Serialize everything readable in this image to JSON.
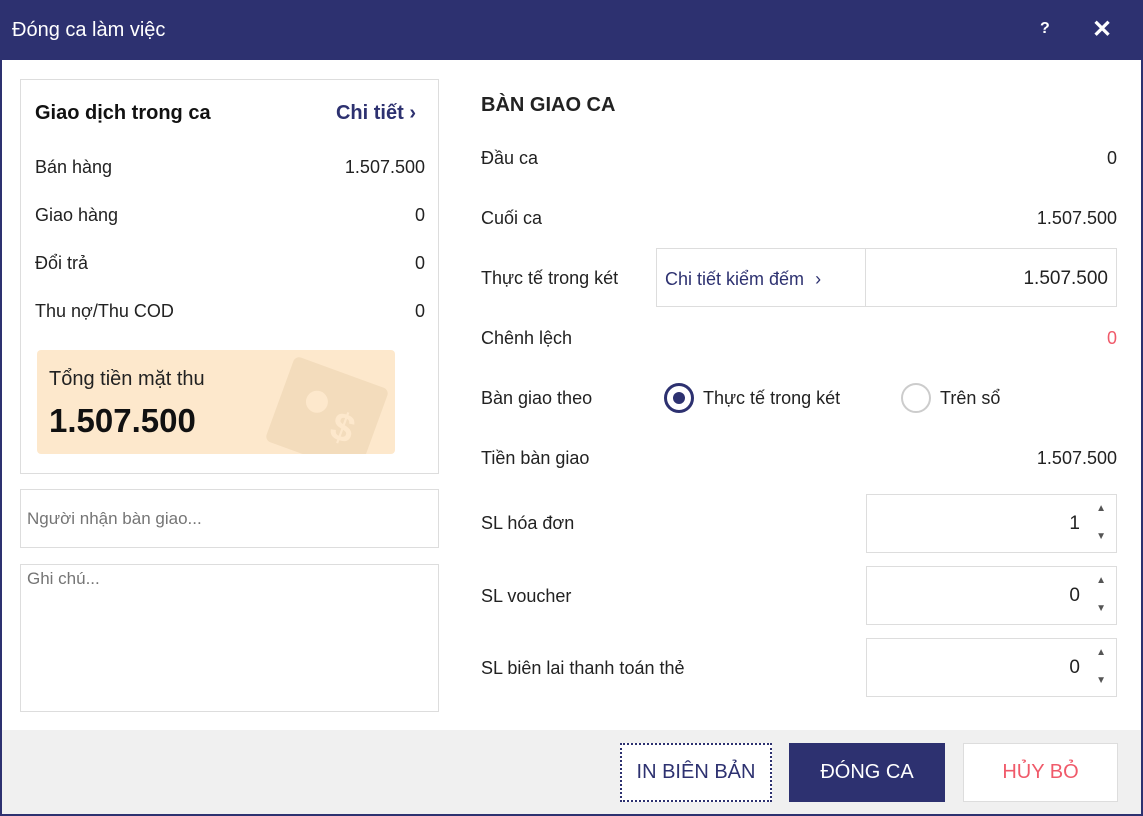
{
  "window": {
    "title": "Đóng ca làm việc",
    "help": "?",
    "close": "✕"
  },
  "left": {
    "heading": "Giao dịch trong ca",
    "detail_link": "Chi tiết",
    "chevron": "›",
    "rows": [
      {
        "label": "Bán hàng",
        "value": "1.507.500"
      },
      {
        "label": "Giao hàng",
        "value": "0"
      },
      {
        "label": "Đổi trả",
        "value": "0"
      },
      {
        "label": "Thu nợ/Thu COD",
        "value": "0"
      }
    ],
    "total_label": "Tổng tiền mặt thu",
    "total_value": "1.507.500",
    "receiver_placeholder": "Người nhận bàn giao...",
    "note_placeholder": "Ghi chú..."
  },
  "right": {
    "heading": "BÀN GIAO CA",
    "start_label": "Đầu ca",
    "start_value": "0",
    "end_label": "Cuối ca",
    "end_value": "1.507.500",
    "actual_label": "Thực tế trong két",
    "count_link": "Chi tiết kiểm đếm",
    "actual_value": "1.507.500",
    "diff_label": "Chênh lệch",
    "diff_value": "0",
    "handover_by_label": "Bàn giao theo",
    "option_actual": "Thực tế trong két",
    "option_book": "Trên sổ",
    "handover_amount_label": "Tiền bàn giao",
    "handover_amount_value": "1.507.500",
    "invoice_label": "SL hóa đơn",
    "invoice_value": "1",
    "voucher_label": "SL voucher",
    "voucher_value": "0",
    "card_label": "SL biên lai thanh toán thẻ",
    "card_value": "0"
  },
  "footer": {
    "print": "IN BIÊN BẢN",
    "close_shift": "ĐÓNG CA",
    "cancel": "HỦY BỎ"
  },
  "colors": {
    "primary": "#2d3170",
    "danger": "#f05a6a",
    "total_bg": "#fde8cc"
  }
}
